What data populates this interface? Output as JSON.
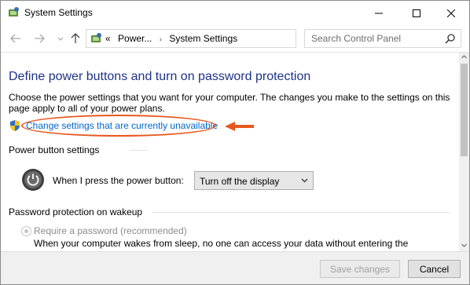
{
  "window": {
    "title": "System Settings",
    "controls": {
      "minimize": "minimize-icon",
      "maximize": "maximize-icon",
      "close": "close-icon"
    }
  },
  "nav": {
    "breadcrumbs": [
      "«",
      "Power...",
      "System Settings"
    ],
    "search_placeholder": "Search Control Panel"
  },
  "main": {
    "heading": "Define power buttons and turn on password protection",
    "description": "Choose the power settings that you want for your computer. The changes you make to the settings on this page apply to all of your power plans.",
    "change_link": "Change settings that are currently unavailable",
    "power_section_title": "Power button settings",
    "power_button_label": "When I press the power button:",
    "power_button_value": "Turn off the display",
    "password_section_title": "Password protection on wakeup",
    "require_password_label": "Require a password (recommended)",
    "wake_text": "When your computer wakes from sleep, no one can access your data without entering the"
  },
  "footer": {
    "save_label": "Save changes",
    "cancel_label": "Cancel"
  },
  "colors": {
    "heading": "#1e3287",
    "link": "#0066cc",
    "annotation": "#e8581e"
  }
}
